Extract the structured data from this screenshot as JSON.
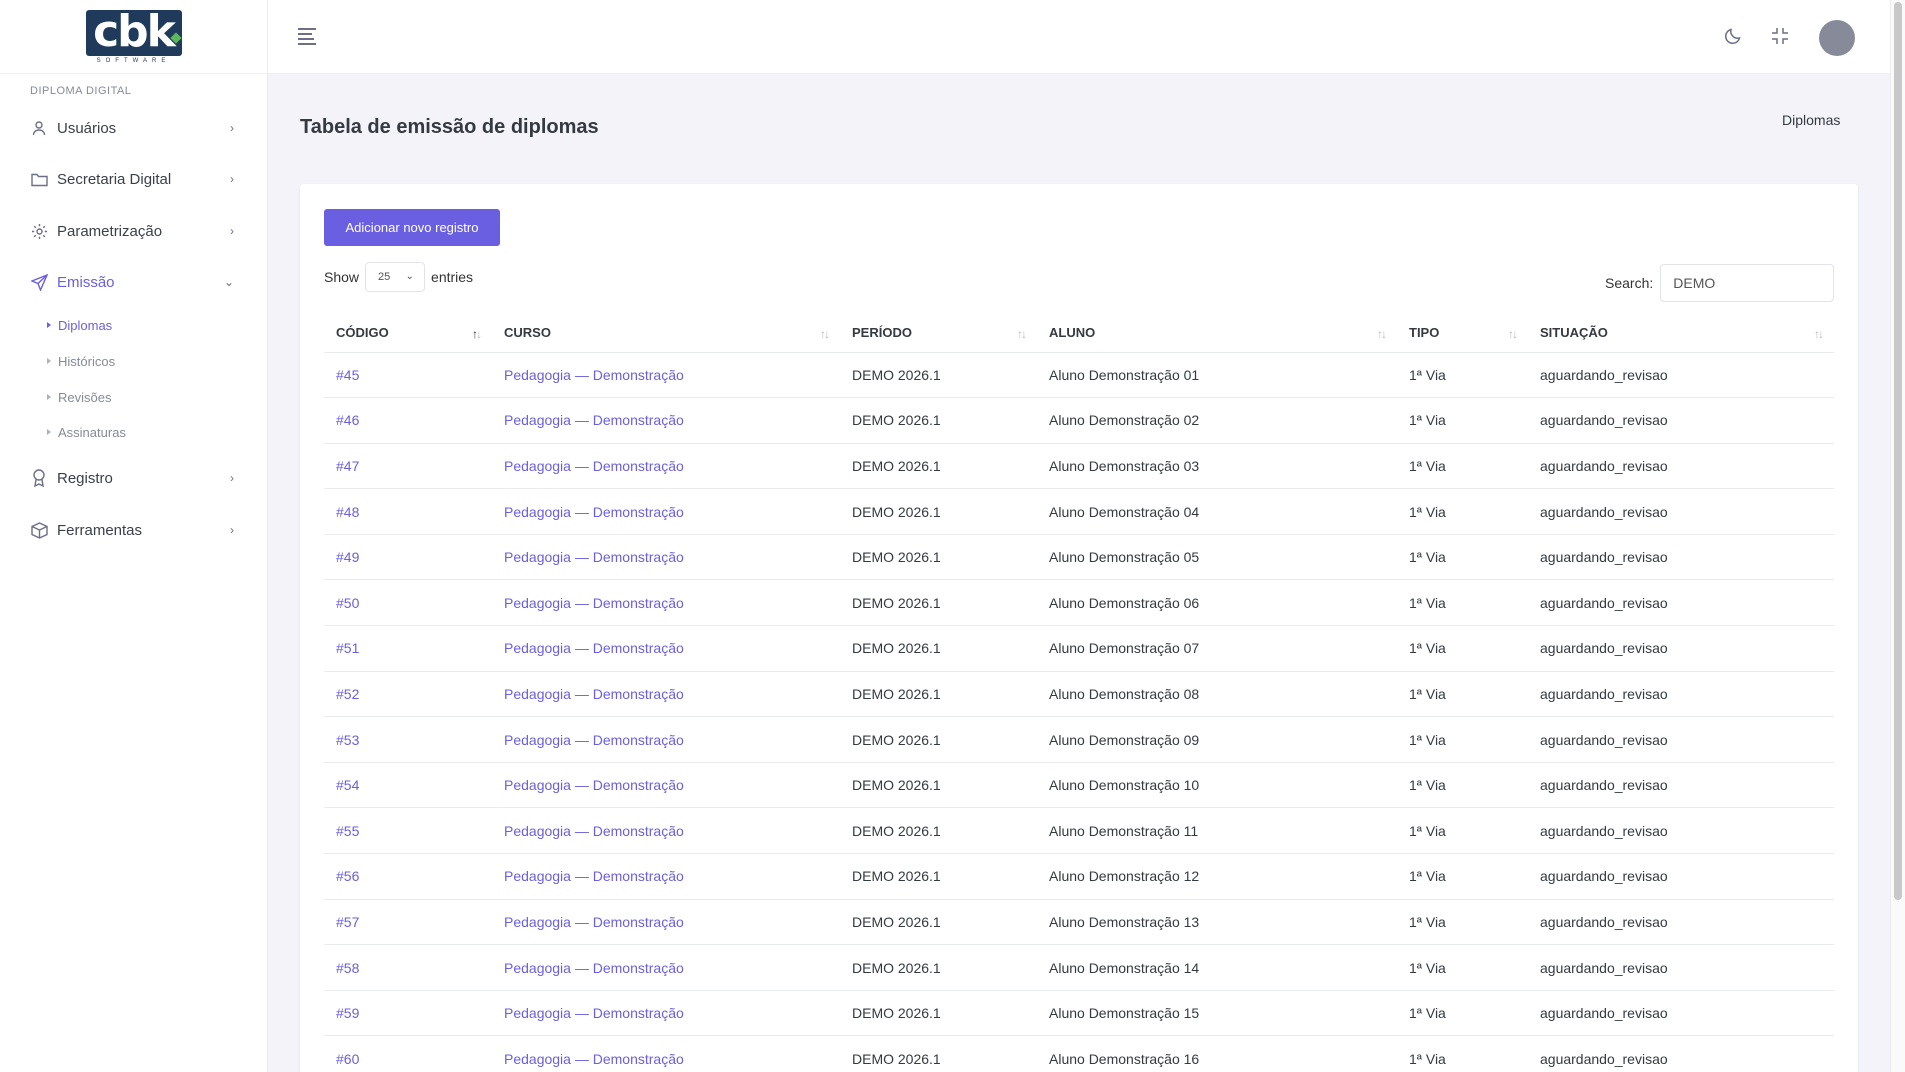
{
  "brand": {
    "logo_text": "cbk",
    "logo_sub": "SOFTWARE"
  },
  "sidebar": {
    "section": "DIPLOMA DIGITAL",
    "items": [
      {
        "label": "Usuários",
        "icon": "user-icon"
      },
      {
        "label": "Secretaria Digital",
        "icon": "folder-icon"
      },
      {
        "label": "Parametrização",
        "icon": "gear-icon"
      },
      {
        "label": "Emissão",
        "icon": "send-icon",
        "expanded": true
      },
      {
        "label": "Registro",
        "icon": "award-icon"
      },
      {
        "label": "Ferramentas",
        "icon": "box-icon"
      }
    ],
    "sub_items": [
      "Diplomas",
      "Históricos",
      "Revisões",
      "Assinaturas"
    ]
  },
  "page": {
    "title": "Tabela de emissão de diplomas",
    "breadcrumb": "Diplomas",
    "add_button": "Adicionar novo registro",
    "show_label": "Show",
    "entries_value": "25",
    "entries_label": "entries",
    "search_label": "Search:",
    "search_value": "DEMO"
  },
  "table": {
    "columns": [
      "Código",
      "Curso",
      "Período",
      "Aluno",
      "Tipo",
      "Situação"
    ],
    "rows": [
      [
        "#45",
        "Pedagogia — Demonstração",
        "DEMO 2026.1",
        "Aluno Demonstração 01",
        "1ª Via",
        "aguardando_revisao"
      ],
      [
        "#46",
        "Pedagogia — Demonstração",
        "DEMO 2026.1",
        "Aluno Demonstração 02",
        "1ª Via",
        "aguardando_revisao"
      ],
      [
        "#47",
        "Pedagogia — Demonstração",
        "DEMO 2026.1",
        "Aluno Demonstração 03",
        "1ª Via",
        "aguardando_revisao"
      ],
      [
        "#48",
        "Pedagogia — Demonstração",
        "DEMO 2026.1",
        "Aluno Demonstração 04",
        "1ª Via",
        "aguardando_revisao"
      ],
      [
        "#49",
        "Pedagogia — Demonstração",
        "DEMO 2026.1",
        "Aluno Demonstração 05",
        "1ª Via",
        "aguardando_revisao"
      ],
      [
        "#50",
        "Pedagogia — Demonstração",
        "DEMO 2026.1",
        "Aluno Demonstração 06",
        "1ª Via",
        "aguardando_revisao"
      ],
      [
        "#51",
        "Pedagogia — Demonstração",
        "DEMO 2026.1",
        "Aluno Demonstração 07",
        "1ª Via",
        "aguardando_revisao"
      ],
      [
        "#52",
        "Pedagogia — Demonstração",
        "DEMO 2026.1",
        "Aluno Demonstração 08",
        "1ª Via",
        "aguardando_revisao"
      ],
      [
        "#53",
        "Pedagogia — Demonstração",
        "DEMO 2026.1",
        "Aluno Demonstração 09",
        "1ª Via",
        "aguardando_revisao"
      ],
      [
        "#54",
        "Pedagogia — Demonstração",
        "DEMO 2026.1",
        "Aluno Demonstração 10",
        "1ª Via",
        "aguardando_revisao"
      ],
      [
        "#55",
        "Pedagogia — Demonstração",
        "DEMO 2026.1",
        "Aluno Demonstração 11",
        "1ª Via",
        "aguardando_revisao"
      ],
      [
        "#56",
        "Pedagogia — Demonstração",
        "DEMO 2026.1",
        "Aluno Demonstração 12",
        "1ª Via",
        "aguardando_revisao"
      ],
      [
        "#57",
        "Pedagogia — Demonstração",
        "DEMO 2026.1",
        "Aluno Demonstração 13",
        "1ª Via",
        "aguardando_revisao"
      ],
      [
        "#58",
        "Pedagogia — Demonstração",
        "DEMO 2026.1",
        "Aluno Demonstração 14",
        "1ª Via",
        "aguardando_revisao"
      ],
      [
        "#59",
        "Pedagogia — Demonstração",
        "DEMO 2026.1",
        "Aluno Demonstração 15",
        "1ª Via",
        "aguardando_revisao"
      ],
      [
        "#60",
        "Pedagogia — Demonstração",
        "DEMO 2026.1",
        "Aluno Demonstração 16",
        "1ª Via",
        "aguardando_revisao"
      ]
    ]
  },
  "colors": {
    "accent": "#6a5fe0",
    "background": "#f3f3f9",
    "text": "#343a40"
  }
}
